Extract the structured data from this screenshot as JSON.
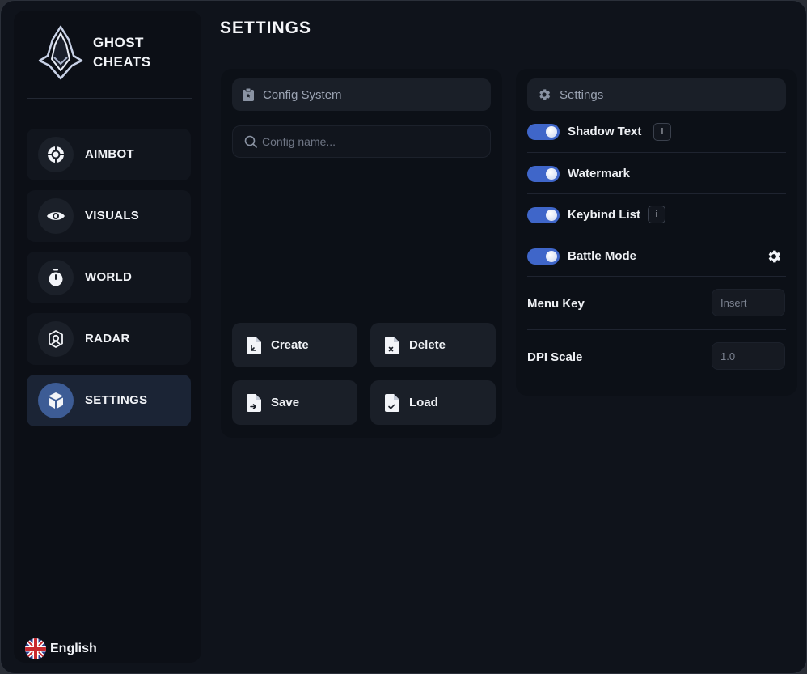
{
  "brand": {
    "line1": "GHOST",
    "line2": "CHEATS"
  },
  "page_title": "SETTINGS",
  "nav": [
    {
      "label": "AIMBOT",
      "icon": "crosshair-icon",
      "active": false
    },
    {
      "label": "VISUALS",
      "icon": "eye-icon",
      "active": false
    },
    {
      "label": "WORLD",
      "icon": "stopwatch-icon",
      "active": false
    },
    {
      "label": "RADAR",
      "icon": "radar-icon",
      "active": false
    },
    {
      "label": "SETTINGS",
      "icon": "box-icon",
      "active": true
    }
  ],
  "language": {
    "label": "English",
    "icon": "uk-flag-icon"
  },
  "config_panel": {
    "header": "Config System",
    "search_placeholder": "Config name...",
    "search_value": "",
    "buttons": {
      "create": "Create",
      "delete": "Delete",
      "save": "Save",
      "load": "Load"
    }
  },
  "settings_panel": {
    "header": "Settings",
    "toggles": [
      {
        "label": "Shadow Text",
        "enabled": true,
        "info": "i"
      },
      {
        "label": "Watermark",
        "enabled": true
      },
      {
        "label": "Keybind List",
        "enabled": true,
        "info": "i"
      },
      {
        "label": "Battle Mode",
        "enabled": true,
        "gear": "gear-icon"
      }
    ],
    "menu_key": {
      "label": "Menu Key",
      "value": "Insert"
    },
    "dpi_scale": {
      "label": "DPI Scale",
      "value": "1.0"
    }
  },
  "colors": {
    "accent": "#3f66c9",
    "window_bg": "#0f131b",
    "panel_bg": "#0c1017",
    "active_nav": "#1b2435"
  }
}
